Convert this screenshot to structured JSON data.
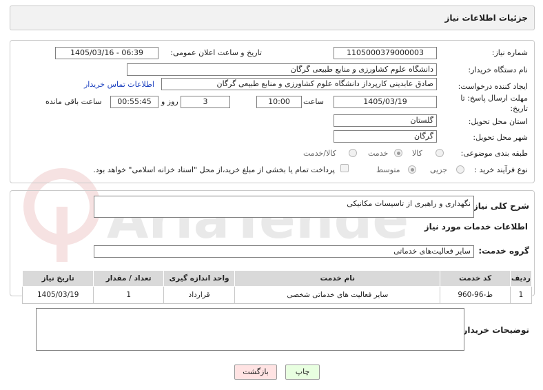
{
  "header": {
    "title": "جزئیات اطلاعات نیاز"
  },
  "fields": {
    "need_number": {
      "label": "شماره نیاز:",
      "value": "1105000379000003"
    },
    "announce_datetime": {
      "label": "تاریخ و ساعت اعلان عمومی:",
      "value": "1405/03/16 - 06:39"
    },
    "buyer_org": {
      "label": "نام دستگاه خریدار:",
      "value": "دانشگاه علوم کشاورزی و منابع طبیعی گرگان"
    },
    "requester": {
      "label": "ایجاد کننده درخواست:",
      "value": "صادق عابدینی کارپرداز دانشگاه علوم کشاورزی و منابع طبیعی گرگان",
      "link": "اطلاعات تماس خریدار"
    },
    "deadline": {
      "label_line1": "مهلت ارسال پاسخ: تا",
      "label_line2": "تاریخ:",
      "date": "1405/03/19",
      "time_label": "ساعت",
      "time": "10:00",
      "days": "3",
      "days_label": "روز و",
      "remaining": "00:55:45",
      "remaining_label": "ساعت باقی مانده"
    },
    "province": {
      "label": "استان محل تحویل:",
      "value": "گلستان"
    },
    "city": {
      "label": "شهر محل تحویل:",
      "value": "گرگان"
    },
    "category": {
      "label": "طبقه بندی موضوعی:",
      "options": [
        "کالا",
        "خدمت",
        "کالا/خدمت"
      ],
      "selected": "خدمت"
    },
    "process_type": {
      "label": "نوع فرآیند خرید :",
      "options": [
        "جزیی",
        "متوسط"
      ],
      "selected": "متوسط",
      "payment_note": "پرداخت تمام یا بخشی از مبلغ خرید،از محل \"اسناد خزانه اسلامی\" خواهد بود."
    }
  },
  "description": {
    "label": "شرح کلی نیاز:",
    "value": "نگهداری و راهبری از تاسیسات مکانیکی"
  },
  "services": {
    "section_title": "اطلاعات خدمات مورد نیاز",
    "group_label": "گروه خدمت:",
    "group_value": "سایر فعالیت‌های خدماتی",
    "columns": [
      "ردیف",
      "کد خدمت",
      "نام خدمت",
      "واحد اندازه گیری",
      "تعداد / مقدار",
      "تاریخ نیاز"
    ],
    "rows": [
      [
        "1",
        "ط-96-960",
        "سایر فعالیت های خدماتی شخصی",
        "قرارداد",
        "1",
        "1405/03/19"
      ]
    ]
  },
  "buyer_notes": {
    "label": "توضیحات خریدار:",
    "value": ""
  },
  "buttons": {
    "print": "چاپ",
    "back": "بازگشت"
  },
  "watermark": {
    "text": "AriaTender.net"
  },
  "colors": {
    "link": "#1a3fbf",
    "back_button_bg": "#ffe3e3",
    "print_button_bg": "#e8ffe0",
    "table_header": "#d9d9d9"
  }
}
